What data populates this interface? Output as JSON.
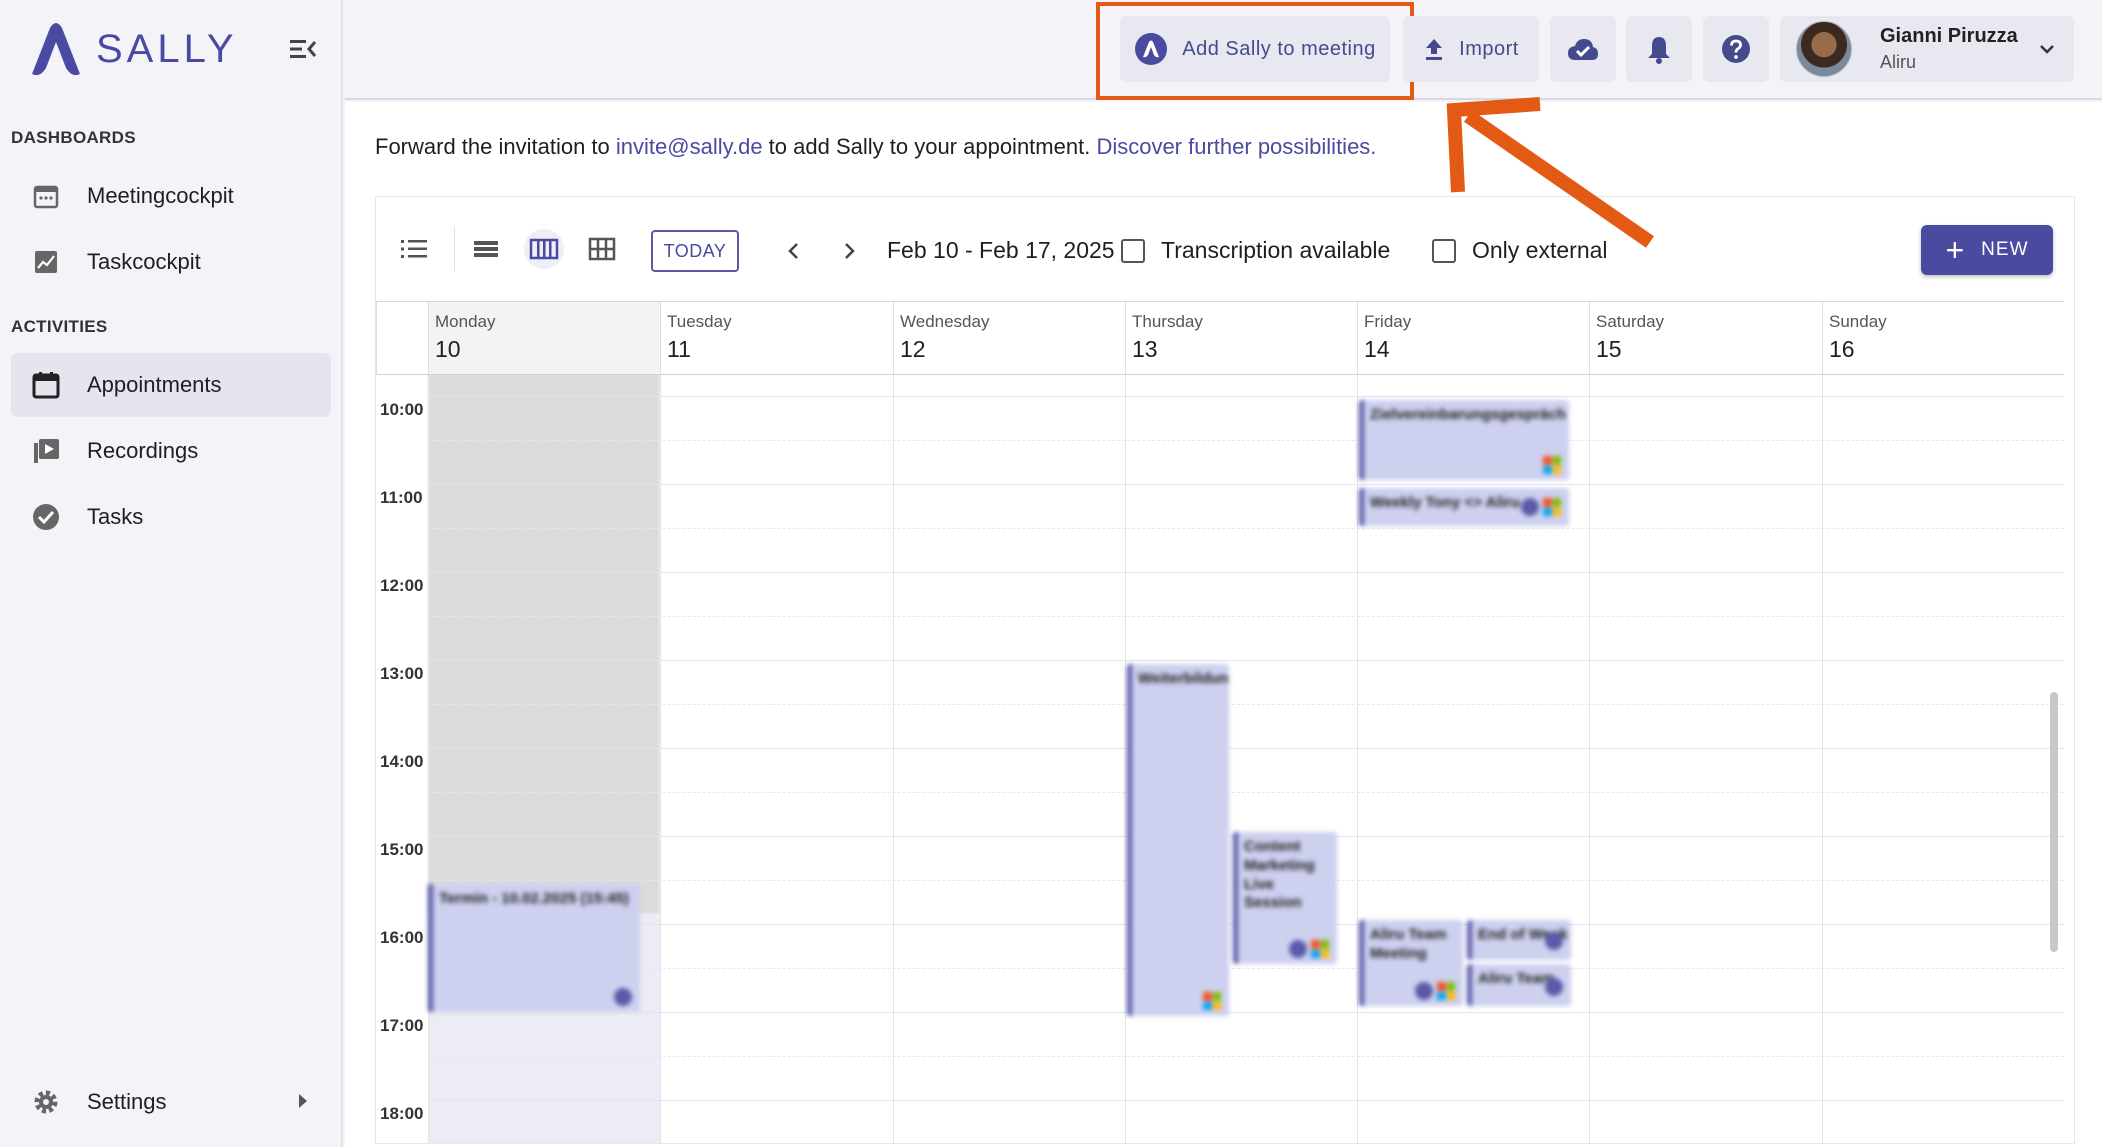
{
  "brand": {
    "name": "SALLY",
    "color": "#4a4aa0"
  },
  "sidebar": {
    "sections": [
      {
        "label": "DASHBOARDS",
        "items": [
          {
            "label": "Meetingcockpit",
            "icon": "calendar-dashboard-icon"
          },
          {
            "label": "Taskcockpit",
            "icon": "chart-icon"
          }
        ]
      },
      {
        "label": "ACTIVITIES",
        "items": [
          {
            "label": "Appointments",
            "icon": "calendar-icon",
            "active": true
          },
          {
            "label": "Recordings",
            "icon": "video-library-icon"
          },
          {
            "label": "Tasks",
            "icon": "check-circle-icon"
          }
        ]
      }
    ],
    "settings_label": "Settings"
  },
  "topbar": {
    "add_sally_label": "Add Sally to meeting",
    "import_label": "Import",
    "user": {
      "name": "Gianni Piruzza",
      "org": "Aliru"
    }
  },
  "info": {
    "prefix": "Forward the invitation to ",
    "email": "invite@sally.de",
    "middle": " to add Sally to your appointment. ",
    "link": "Discover further possibilities."
  },
  "toolbar": {
    "today_label": "TODAY",
    "date_range": "Feb 10 - Feb 17, 2025",
    "transcription_label": "Transcription available",
    "only_external_label": "Only external",
    "new_label": "NEW"
  },
  "calendar": {
    "days": [
      {
        "name": "Monday",
        "num": "10"
      },
      {
        "name": "Tuesday",
        "num": "11"
      },
      {
        "name": "Wednesday",
        "num": "12"
      },
      {
        "name": "Thursday",
        "num": "13"
      },
      {
        "name": "Friday",
        "num": "14"
      },
      {
        "name": "Saturday",
        "num": "15"
      },
      {
        "name": "Sunday",
        "num": "16"
      }
    ],
    "hours": [
      "10:00",
      "11:00",
      "12:00",
      "13:00",
      "14:00",
      "15:00",
      "16:00",
      "17:00",
      "18:00"
    ],
    "events": [
      {
        "title": "Zielvereinbarungsgespräch"
      },
      {
        "title": "Weekly Tony <> Aliru"
      },
      {
        "title": "Weiterbildung"
      },
      {
        "title": "Content Marketing Live Session"
      },
      {
        "title": "Termin - 10.02.2025 (15:45)"
      },
      {
        "title": "Aliru Team Meeting"
      },
      {
        "title": "End of Week"
      },
      {
        "title": "Aliru Team"
      }
    ]
  },
  "colors": {
    "accent": "#4a4aa0",
    "highlight": "#e35a14",
    "event_bg": "#cdd0ef"
  }
}
